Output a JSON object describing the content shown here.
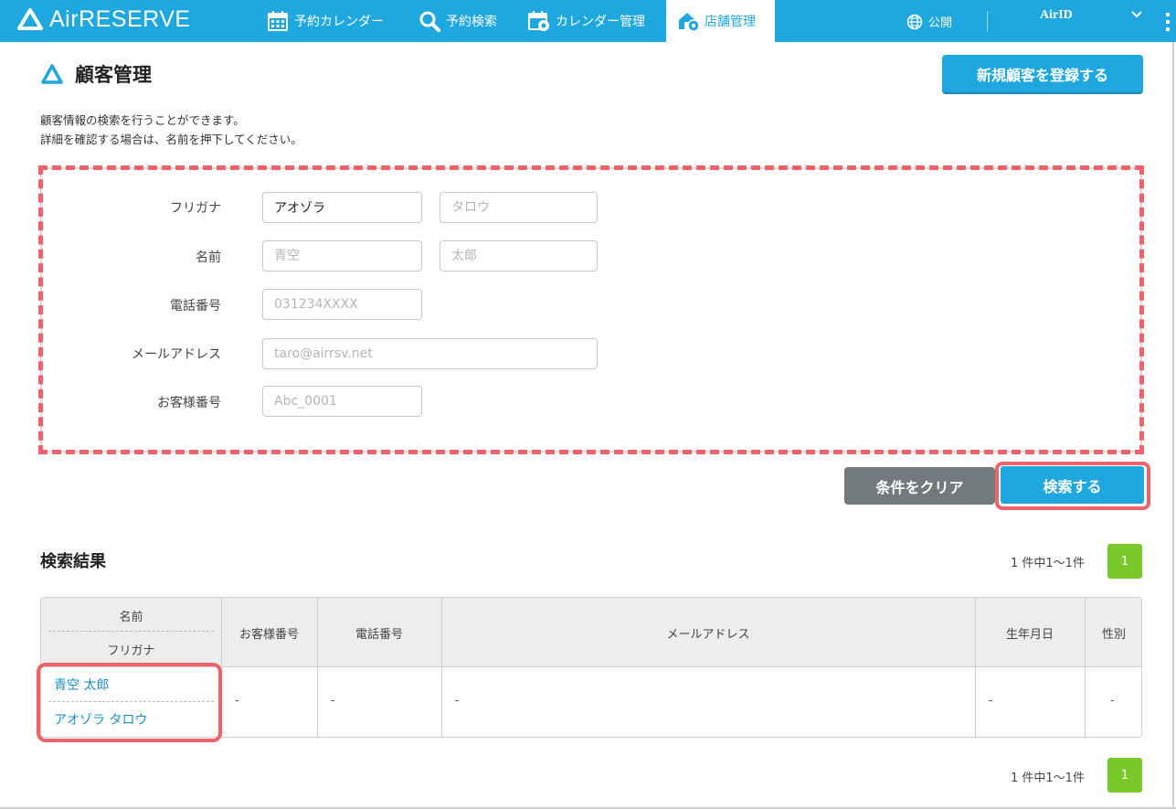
{
  "header": {
    "logo_text": "AirRESERVE",
    "nav": [
      {
        "label": "予約カレンダー",
        "icon": "calendar-icon",
        "active": false
      },
      {
        "label": "予約検索",
        "icon": "search-icon",
        "active": false
      },
      {
        "label": "カレンダー管理",
        "icon": "calendar-settings-icon",
        "active": false
      },
      {
        "label": "店舗管理",
        "icon": "store-settings-icon",
        "active": true
      }
    ],
    "publish_label": "公開",
    "airid_label": "AirID"
  },
  "page": {
    "title": "顧客管理",
    "register_button": "新規顧客を登録する",
    "description_line1": "顧客情報の検索を行うことができます。",
    "description_line2": "詳細を確認する場合は、名前を押下してください。"
  },
  "form": {
    "furigana_label": "フリガナ",
    "furigana_last_value": "アオゾラ",
    "furigana_first_placeholder": "タロウ",
    "name_label": "名前",
    "name_last_placeholder": "青空",
    "name_first_placeholder": "太郎",
    "phone_label": "電話番号",
    "phone_placeholder": "031234XXXX",
    "email_label": "メールアドレス",
    "email_placeholder": "taro@airrsv.net",
    "customer_no_label": "お客様番号",
    "customer_no_placeholder": "Abc_0001",
    "clear_button": "条件をクリア",
    "search_button": "検索する"
  },
  "results": {
    "title": "検索結果",
    "count_text": "1 件中1～1件",
    "page": "1",
    "columns": {
      "name": "名前",
      "furigana": "フリガナ",
      "customer_no": "お客様番号",
      "phone": "電話番号",
      "email": "メールアドレス",
      "birthday": "生年月日",
      "gender": "性別"
    },
    "rows": [
      {
        "name": "青空 太郎",
        "furigana": "アオゾラ タロウ",
        "customer_no": "-",
        "phone": "-",
        "email": "-",
        "birthday": "-",
        "gender": "-"
      }
    ]
  },
  "colors": {
    "brand": "#1fa7e0",
    "highlight": "#f0626b",
    "page_active": "#7ac92b",
    "clear_button": "#737a7c"
  }
}
